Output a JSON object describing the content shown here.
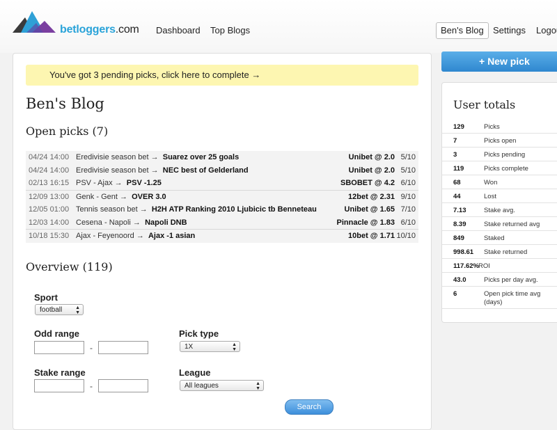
{
  "header": {
    "logo_text_main": "betloggers",
    "logo_text_tld": ".com",
    "nav": [
      "Dashboard",
      "Top Blogs"
    ],
    "right_nav": {
      "blog": "Ben's Blog",
      "settings": "Settings",
      "logout": "Logout"
    }
  },
  "notice": "You've got 3 pending picks, click here to complete →",
  "main": {
    "title": "Ben's Blog",
    "open_picks_heading": "Open picks (7)",
    "overview_heading": "Overview (119)"
  },
  "picks": [
    {
      "date": "04/24 14:00",
      "league": "Eredivisie season bet →",
      "pick": "Suarez over 25 goals",
      "odds": "Unibet @ 2.0",
      "stake": "5/10"
    },
    {
      "date": "04/24 14:00",
      "league": "Eredivisie season bet →",
      "pick": "NEC best of Gelderland",
      "odds": "Unibet @ 2.0",
      "stake": "5/10"
    },
    {
      "date": "02/13 16:15",
      "league": "PSV - Ajax →",
      "pick": "PSV -1.25",
      "odds": "SBOBET @ 4.2",
      "stake": "6/10"
    },
    {
      "date": "12/09 13:00",
      "league": "Genk - Gent →",
      "pick": "OVER 3.0",
      "odds": "12bet @ 2.31",
      "stake": "9/10"
    },
    {
      "date": "12/05 01:00",
      "league": "Tennis season bet →",
      "pick": "H2H ATP Ranking 2010 Ljubicic tb Benneteau",
      "odds": "Unibet @ 1.65",
      "stake": "7/10"
    },
    {
      "date": "12/03 14:00",
      "league": "Cesena - Napoli →",
      "pick": "Napoli DNB",
      "odds": "Pinnacle @ 1.83",
      "stake": "6/10"
    },
    {
      "date": "10/18 15:30",
      "league": "Ajax - Feyenoord →",
      "pick": "Ajax -1 asian",
      "odds": "10bet @ 1.71",
      "stake": "10/10"
    }
  ],
  "filters": {
    "sport_label": "Sport",
    "sport_value": "football",
    "odd_range_label": "Odd range",
    "pick_type_label": "Pick type",
    "pick_type_value": "1X",
    "stake_range_label": "Stake range",
    "league_label": "League",
    "league_value": "All leagues",
    "range_separator": "-",
    "search_label": "Search"
  },
  "sidebar": {
    "new_pick_label": "+ New pick",
    "totals_title": "User totals",
    "totals": [
      {
        "value": "129",
        "label": "Picks"
      },
      {
        "value": "7",
        "label": "Picks open"
      },
      {
        "value": "3",
        "label": "Picks pending"
      },
      {
        "value": "119",
        "label": "Picks complete"
      },
      {
        "value": "68",
        "label": "Won"
      },
      {
        "value": "44",
        "label": "Lost"
      },
      {
        "value": "7.13",
        "label": "Stake avg."
      },
      {
        "value": "8.39",
        "label": "Stake returned avg"
      },
      {
        "value": "849",
        "label": "Staked"
      },
      {
        "value": "998.61",
        "label": "Stake returned"
      },
      {
        "value": "117.62%",
        "label": "ROI"
      },
      {
        "value": "43.0",
        "label": "Picks per day avg."
      },
      {
        "value": "6",
        "label": "Open pick time avg (days)"
      }
    ]
  },
  "colors": {
    "accent": "#2f87cf",
    "notice_bg": "#fdf6b1",
    "logo_blue": "#29a3d9",
    "logo_purple": "#7b3fa0"
  }
}
